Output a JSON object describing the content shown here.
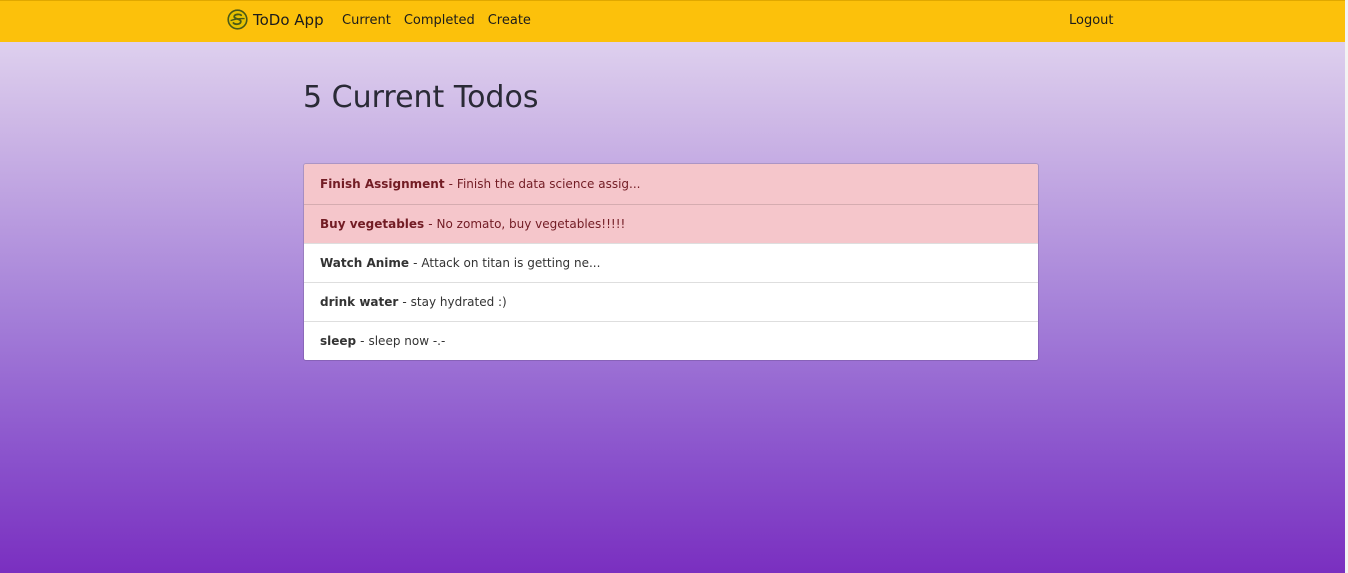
{
  "navbar": {
    "brand_name": "ToDo App",
    "brand_icon": "s-logo-icon",
    "links": [
      "Current",
      "Completed",
      "Create"
    ],
    "logout_label": "Logout",
    "background_color": "#fcc10b"
  },
  "main": {
    "title": "5 Current Todos",
    "todos": [
      {
        "name": "Finish Assignment",
        "separator": "-",
        "description": "Finish the data science assig...",
        "urgent": true
      },
      {
        "name": "Buy vegetables",
        "separator": "-",
        "description": "No zomato, buy vegetables!!!!!",
        "urgent": true
      },
      {
        "name": "Watch Anime",
        "separator": "-",
        "description": "Attack on titan is getting ne...",
        "urgent": false
      },
      {
        "name": "drink water",
        "separator": "-",
        "description": "stay hydrated :)",
        "urgent": false
      },
      {
        "name": "sleep",
        "separator": "-",
        "description": "sleep now -.-",
        "urgent": false
      }
    ],
    "urgent_color": "#f5c6cb"
  }
}
